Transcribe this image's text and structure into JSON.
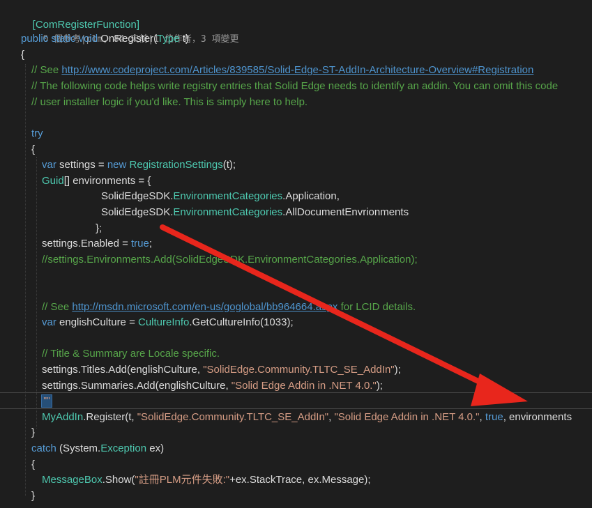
{
  "lines": {
    "l1_attr": "[ComRegisterFunction]",
    "l2_codelens": "0 個參考|plm, 84 天前|1 位作者，3 項變更",
    "l3_kw": "public static void",
    "l3_name": " OnRegister(",
    "l3_type": "Type",
    "l3_rest": " t)",
    "l4": "{",
    "l5_comment": "// See ",
    "l5_link": "http://www.codeproject.com/Articles/839585/Solid-Edge-ST-AddIn-Architecture-Overview#Registration",
    "l6_comment": "// The following code helps write registry entries that Solid Edge needs to identify an addin. You can omit this code",
    "l7_comment": "// user installer logic if you'd like. This is simply here to help.",
    "l9_try": "try",
    "l10": "{",
    "l11_var": "var",
    "l11_a": " settings = ",
    "l11_new": "new",
    "l11_type": " RegistrationSettings",
    "l11_rest": "(t);",
    "l12_type": "Guid",
    "l12_rest": "[] environments = {",
    "l13_type1": "SolidEdgeSDK",
    "l13_dot1": ".",
    "l13_type2": "EnvironmentCategories",
    "l13_rest": ".Application,",
    "l14_type1": "SolidEdgeSDK",
    "l14_dot1": ".",
    "l14_type2": "EnvironmentCategories",
    "l14_rest": ".AllDocumentEnvrionments",
    "l15": "};",
    "l16_a": "settings.Enabled = ",
    "l16_true": "true",
    "l16_rest": ";",
    "l17_comment": "//settings.Environments.Add(SolidEdgeSDK.EnvironmentCategories.Application);",
    "l20_comment": "// See ",
    "l20_link": "http://msdn.microsoft.com/en-us/goglobal/bb964664.aspx",
    "l20_tail": " for LCID details.",
    "l21_var": "var",
    "l21_a": " englishCulture = ",
    "l21_type": "CultureInfo",
    "l21_rest": ".GetCultureInfo(1033);",
    "l23_comment": "// Title & Summary are Locale specific.",
    "l24_a": "settings.Titles.Add(englishCulture, ",
    "l24_str": "\"SolidEdge.Community.TLTC_SE_AddIn\"",
    "l24_rest": ");",
    "l25_a": "settings.Summaries.Add(englishCulture, ",
    "l25_str": "\"Solid Edge Addin in .NET 4.0.\"",
    "l25_rest": ");",
    "l26_caret": "\"\"",
    "l27_type": "MyAddIn",
    "l27_a": ".Register(t, ",
    "l27_str1": "\"SolidEdge.Community.TLTC_SE_AddIn\"",
    "l27_b": ", ",
    "l27_str2": "\"Solid Edge Addin in .NET 4.0.\"",
    "l27_c": ", ",
    "l27_true": "true",
    "l27_rest": ", environments",
    "l28": "}",
    "l29_catch": "catch",
    "l29_a": " (System.",
    "l29_type": "Exception",
    "l29_rest": " ex)",
    "l30": "{",
    "l31_type": "MessageBox",
    "l31_a": ".Show(",
    "l31_str": "\"註冊PLM元件失敗:\"",
    "l31_rest": "+ex.StackTrace, ex.Message);",
    "l32": "}"
  },
  "colors": {
    "background": "#1e1e1e",
    "keyword": "#569cd6",
    "type": "#4ec9b0",
    "string": "#d69d85",
    "comment": "#57a64a",
    "arrow": "#e8261c"
  }
}
